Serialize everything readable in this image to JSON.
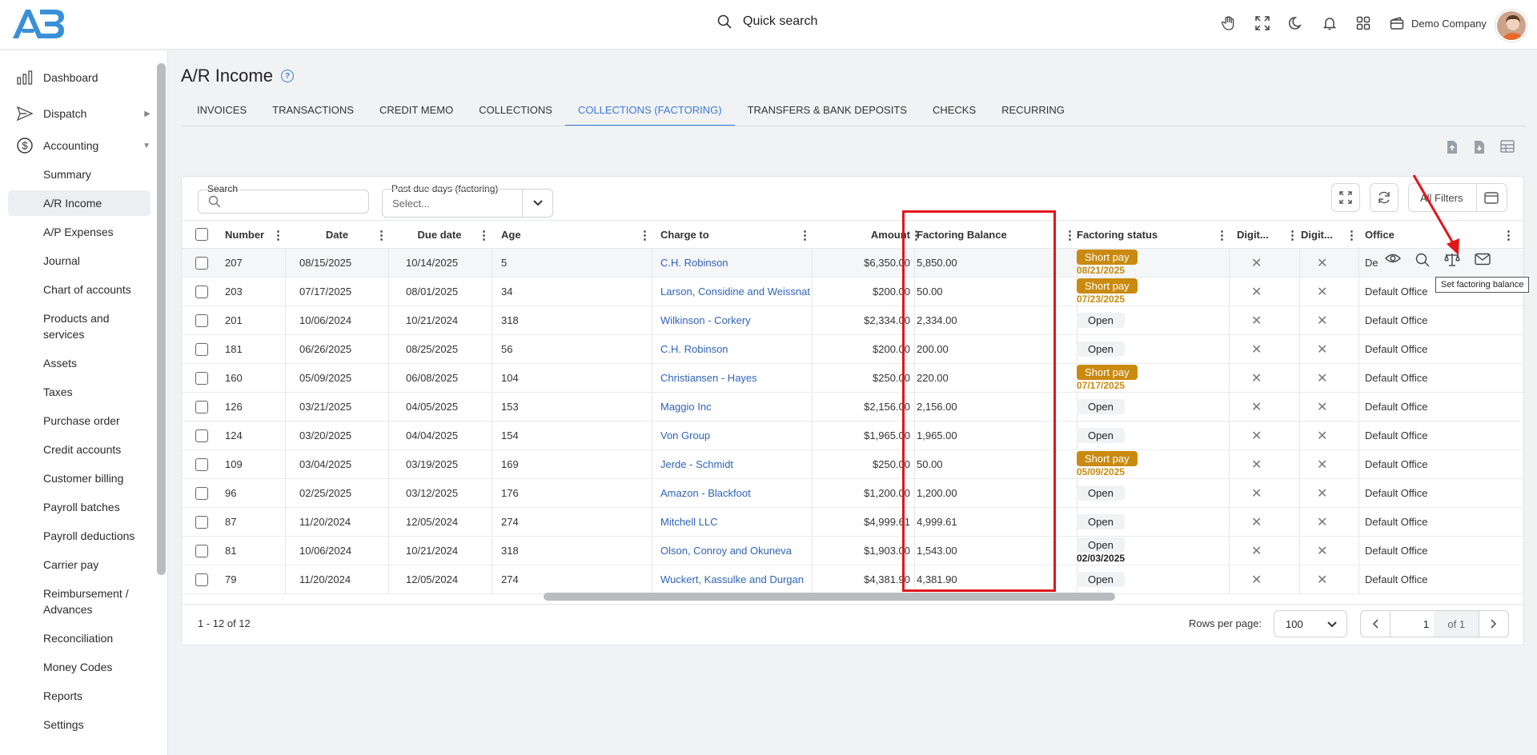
{
  "header": {
    "search_label": "Quick search",
    "company": "Demo Company",
    "icons": [
      "hand-icon",
      "fullscreen-icon",
      "moon-icon",
      "bell-icon",
      "grid-icon",
      "wallet-icon"
    ]
  },
  "sidebar": {
    "items": [
      {
        "label": "Dashboard",
        "icon": "chart-icon"
      },
      {
        "label": "Dispatch",
        "icon": "send-icon",
        "arrow": "▶"
      },
      {
        "label": "Accounting",
        "icon": "dollar-icon",
        "arrow": "▼"
      }
    ],
    "sub_items": [
      "Summary",
      "A/R Income",
      "A/P Expenses",
      "Journal",
      "Chart of accounts",
      "Products and services",
      "Assets",
      "Taxes",
      "Purchase order",
      "Credit accounts",
      "Customer billing",
      "Payroll batches",
      "Payroll deductions",
      "Carrier pay",
      "Reimbursement / Advances",
      "Reconciliation",
      "Money Codes",
      "Reports",
      "Settings"
    ]
  },
  "page": {
    "title": "A/R Income",
    "tabs": [
      "INVOICES",
      "TRANSACTIONS",
      "CREDIT MEMO",
      "COLLECTIONS",
      "COLLECTIONS (FACTORING)",
      "TRANSFERS & BANK DEPOSITS",
      "CHECKS",
      "RECURRING"
    ],
    "active_tab": "COLLECTIONS (FACTORING)"
  },
  "filters": {
    "search_label": "Search",
    "due_label": "Past due days (factoring)",
    "due_placeholder": "Select...",
    "all_filters": "All Filters"
  },
  "table": {
    "columns": [
      "Number",
      "Date",
      "Due date",
      "Age",
      "Charge to",
      "Amount",
      "Factoring Balance",
      "Factoring status",
      "Digit...",
      "Digit...",
      "Office"
    ],
    "rows": [
      {
        "number": "207",
        "date": "08/15/2025",
        "due": "10/14/2025",
        "age": "5",
        "charge_to": "C.H. Robinson",
        "amount": "$6,350.00",
        "balance": "5,850.00",
        "status": "Short pay",
        "status_date": "08/21/2025",
        "office": "De"
      },
      {
        "number": "203",
        "date": "07/17/2025",
        "due": "08/01/2025",
        "age": "34",
        "charge_to": "Larson, Considine and Weissnat",
        "amount": "$200.00",
        "balance": "50.00",
        "status": "Short pay",
        "status_date": "07/23/2025",
        "office": "Default Office"
      },
      {
        "number": "201",
        "date": "10/06/2024",
        "due": "10/21/2024",
        "age": "318",
        "charge_to": "Wilkinson - Corkery",
        "amount": "$2,334.00",
        "balance": "2,334.00",
        "status": "Open",
        "status_date": "",
        "office": "Default Office"
      },
      {
        "number": "181",
        "date": "06/26/2025",
        "due": "08/25/2025",
        "age": "56",
        "charge_to": "C.H. Robinson",
        "amount": "$200.00",
        "balance": "200.00",
        "status": "Open",
        "status_date": "",
        "office": "Default Office"
      },
      {
        "number": "160",
        "date": "05/09/2025",
        "due": "06/08/2025",
        "age": "104",
        "charge_to": "Christiansen - Hayes",
        "amount": "$250.00",
        "balance": "220.00",
        "status": "Short pay",
        "status_date": "07/17/2025",
        "office": "Default Office"
      },
      {
        "number": "126",
        "date": "03/21/2025",
        "due": "04/05/2025",
        "age": "153",
        "charge_to": "Maggio Inc",
        "amount": "$2,156.00",
        "balance": "2,156.00",
        "status": "Open",
        "status_date": "",
        "office": "Default Office"
      },
      {
        "number": "124",
        "date": "03/20/2025",
        "due": "04/04/2025",
        "age": "154",
        "charge_to": "Von Group",
        "amount": "$1,965.00",
        "balance": "1,965.00",
        "status": "Open",
        "status_date": "",
        "office": "Default Office"
      },
      {
        "number": "109",
        "date": "03/04/2025",
        "due": "03/19/2025",
        "age": "169",
        "charge_to": "Jerde - Schmidt",
        "amount": "$250.00",
        "balance": "50.00",
        "status": "Short pay",
        "status_date": "05/09/2025",
        "office": "Default Office"
      },
      {
        "number": "96",
        "date": "02/25/2025",
        "due": "03/12/2025",
        "age": "176",
        "charge_to": "Amazon - Blackfoot",
        "amount": "$1,200.00",
        "balance": "1,200.00",
        "status": "Open",
        "status_date": "",
        "office": "Default Office"
      },
      {
        "number": "87",
        "date": "11/20/2024",
        "due": "12/05/2024",
        "age": "274",
        "charge_to": "Mitchell LLC",
        "amount": "$4,999.61",
        "balance": "4,999.61",
        "status": "Open",
        "status_date": "",
        "office": "Default Office"
      },
      {
        "number": "81",
        "date": "10/06/2024",
        "due": "10/21/2024",
        "age": "318",
        "charge_to": "Olson, Conroy and Okuneva",
        "amount": "$1,903.00",
        "balance": "1,543.00",
        "status": "Open",
        "status_date": "02/03/2025",
        "office": "Default Office"
      },
      {
        "number": "79",
        "date": "11/20/2024",
        "due": "12/05/2024",
        "age": "274",
        "charge_to": "Wuckert, Kassulke and Durgan",
        "amount": "$4,381.90",
        "balance": "4,381.90",
        "status": "Open",
        "status_date": "",
        "office": "Default Office"
      }
    ]
  },
  "footer": {
    "range": "1 - 12 of 12",
    "rows_per_page_label": "Rows per page:",
    "rows_per_page": "100",
    "page": "1",
    "of_pages": "of 1"
  },
  "tooltip": "Set factoring balance",
  "colors": {
    "accent": "#3a7bd5",
    "short_pay": "#c98a0f",
    "highlight": "#e0161b"
  }
}
